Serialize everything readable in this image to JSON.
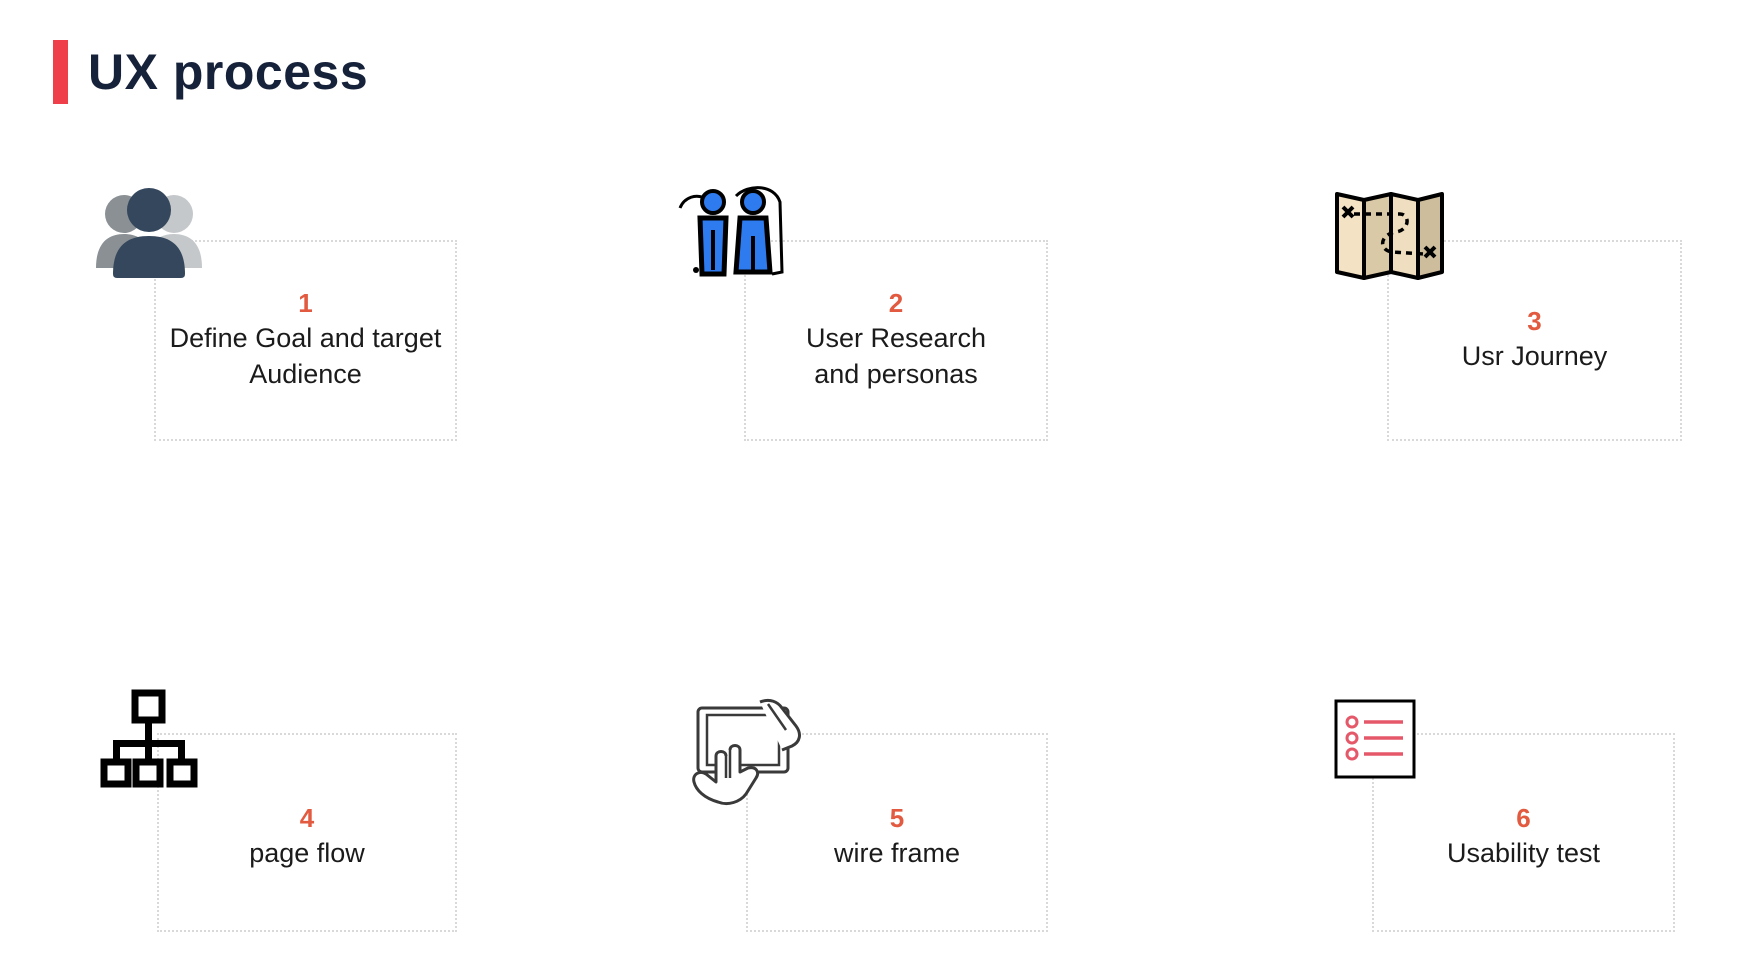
{
  "title": "UX process",
  "accent_color": "#ee3f4a",
  "number_color": "#e25a3f",
  "steps": [
    {
      "number": "1",
      "label": "Define Goal and target\nAudience",
      "icon": "users-group-icon"
    },
    {
      "number": "2",
      "label": "User Research\nand personas",
      "icon": "personas-icon"
    },
    {
      "number": "3",
      "label": "Usr Journey",
      "icon": "journey-map-icon"
    },
    {
      "number": "4",
      "label": "page flow",
      "icon": "sitemap-icon"
    },
    {
      "number": "5",
      "label": "wire frame",
      "icon": "tablet-touch-icon"
    },
    {
      "number": "6",
      "label": "Usability test",
      "icon": "checklist-icon"
    }
  ]
}
